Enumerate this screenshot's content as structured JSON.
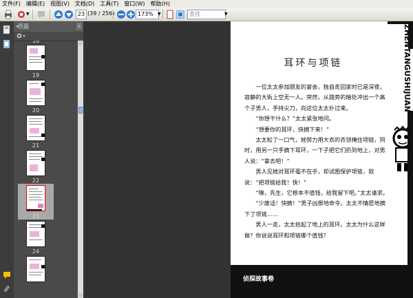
{
  "menu": [
    "文件(F)",
    "编辑(E)",
    "视图(V)",
    "文档(D)",
    "工具(T)",
    "窗口(W)",
    "帮助(H)"
  ],
  "toolbar": {
    "page_current": "23",
    "page_count": "(39 / 256)",
    "zoom": "173%",
    "search_placeholder": "查找"
  },
  "thumbpanel": {
    "title": "页面",
    "pages": [
      "18",
      "19",
      "20",
      "21",
      "22",
      "23",
      "24"
    ]
  },
  "document": {
    "side_title": "ZHENTANGUSHIJUAN",
    "title": "耳环与项链",
    "paragraphs": [
      "一位太太参加朋友的宴会，独自走回家时已是深夜，寂静的大街上空无一人。突然，从路旁的暗处冲出一个高个子男人，手持尖刀，向这位太太扑过来。",
      "“你想干什么？”太太紧张地问。",
      "“想要你的耳环，快摘下来！”",
      "太太松了一口气，她努力用大衣的衣领掩住项链，同时，用另一只手摘下耳环，一下子把它们扔到地上，对男人说：“拿去吧！”",
      "男人见她对耳环毫不在乎，却试图保护项链，就说：“把项链给我！快！”",
      "“噢，先生，它根本不值钱，给我留下吧。”太太请求。",
      "“少废话！快摘！”男子凶狠地命令。太太不情愿地摘下了项链……",
      "男人一走，太太拾起了地上的耳环。太太为什么这样做？你说说耳环和项链哪个值钱？"
    ],
    "footer": "侦探故事卷"
  }
}
